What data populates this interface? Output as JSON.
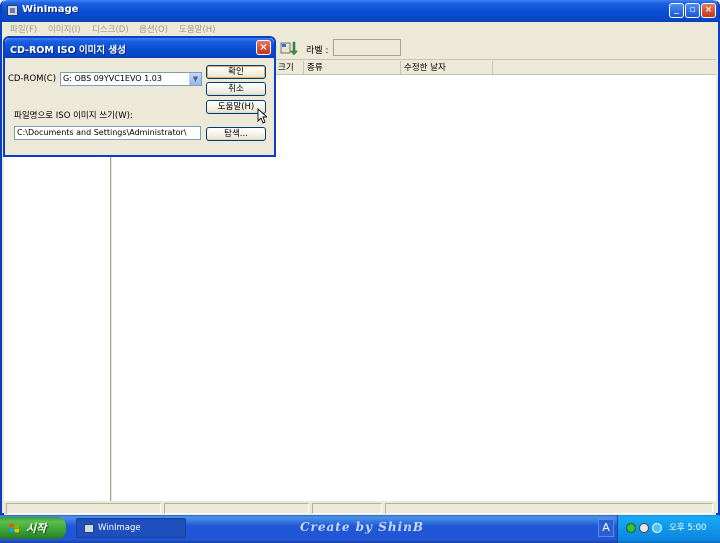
{
  "window": {
    "title": "WinImage"
  },
  "menu": [
    "파일(F)",
    "이미지(I)",
    "디스크(D)",
    "옵션(O)",
    "도움말(H)"
  ],
  "toolbar": {
    "label_text": "라벨 :"
  },
  "list_columns": [
    "크기",
    "종류",
    "수정한 날자"
  ],
  "dialog": {
    "title": "CD-ROM ISO 이미지 생성",
    "cdrom_label": "CD-ROM(C)",
    "cdrom_value": "G: OBS 09YVC1EVO 1.03",
    "file_label": "파일명으로 ISO 이미지 쓰기(W):",
    "file_value": "C:\\Documents and Settings\\Administrator\\",
    "buttons": {
      "ok": "확인",
      "cancel": "취소",
      "help": "도움말(H)",
      "browse": "탐색..."
    }
  },
  "taskbar": {
    "start": "시작",
    "task": "WinImage",
    "signature": "Create by ShinB",
    "ime": "A",
    "clock": "오후 5:00"
  },
  "colors": {
    "xp_blue": "#0a4fd4",
    "start_green": "#359a2f",
    "tray_blue": "#0c85e0"
  },
  "icons": [
    "app-icon",
    "minimize-icon",
    "maximize-icon",
    "close-icon",
    "extract-icon",
    "windows-flag-icon",
    "mouse-cursor-icon"
  ]
}
